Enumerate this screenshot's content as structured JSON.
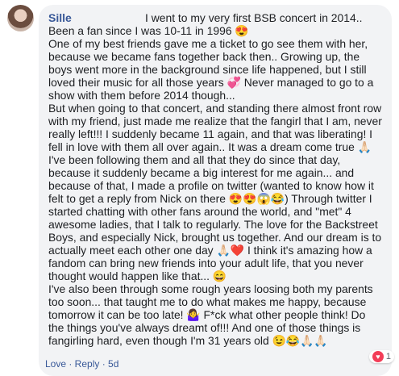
{
  "comment": {
    "author": "Sille",
    "text": "I went to my very first BSB concert in 2014.. Been a fan since I was 10-11 in 1996 😍\nOne of my best friends gave me a ticket to go see them with her, because we became fans together back then.. Growing up, the boys went more in the background since life happened, but I still loved their music for all those years 💞 Never managed to go to a show with them before 2014 though...\nBut when going to that concert, and standing there almost front row with my friend, just made me realize that the fangirl that I am, never really left!!! I suddenly became 11 again, and that was liberating! I fell in love with them all over again.. It was a dream come true 🙏🏻\nI've been following them and all that they do since that day, because it suddenly became a big interest for me again... and because of that, I made a profile on twitter (wanted to know how it felt to get a reply from Nick on there 😍😍😱😂) Through twitter I started chatting with other fans around the world, and \"met\" 4 awesome ladies, that I talk to regularly. The love for the Backstreet Boys, and especially Nick, brought us together. And our dream is to actually meet each other one day 🙏🏻❤️ I think it's amazing how a fandom can bring new friends into your adult life, that you never thought would happen like that... 😄\nI've also been through some rough years loosing both my parents too soon... that taught me to do what makes me happy, because tomorrow it can be too late! 🤷‍♀️ F*ck what other people think! Do the things you've always dreamt of!!! And one of those things is fangirling hard, even though I'm 31 years old 😉😂🙏🏻🙏🏻",
    "reaction_count": "1",
    "reaction_icon": "heart-reaction-icon",
    "footer_links": "Love · Reply · 5d"
  }
}
